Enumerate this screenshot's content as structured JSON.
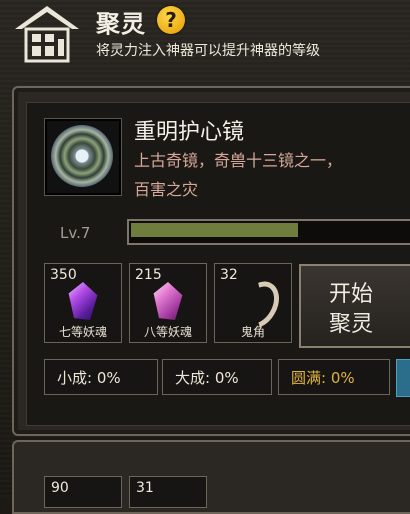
{
  "header": {
    "title": "聚灵",
    "help_label": "?",
    "subtitle": "将灵力注入神器可以提升神器的等级"
  },
  "artifact": {
    "name": "重明护心镜",
    "description_line1": "上古奇镜，奇兽十三镜之一，",
    "description_line2": "百害之灾",
    "level": "Lv.7",
    "progress": 0.6
  },
  "materials": [
    {
      "count": "350",
      "label": "七等妖魂",
      "icon": "purple-gem-icon"
    },
    {
      "count": "215",
      "label": "八等妖魂",
      "icon": "pink-gem-icon"
    },
    {
      "count": "32",
      "label": "鬼角",
      "icon": "horn-icon"
    }
  ],
  "start_button": {
    "line1": "开始",
    "line2": "聚灵"
  },
  "stats": [
    {
      "label": "小成: 0%"
    },
    {
      "label": "大成: 0%"
    },
    {
      "label": "圆满: 0%"
    }
  ],
  "lower_panel": {
    "counts": [
      "90",
      "31"
    ]
  },
  "colors": {
    "progress": "#6f7d3d",
    "gold": "#e0b340",
    "help": "#f2b40a"
  }
}
